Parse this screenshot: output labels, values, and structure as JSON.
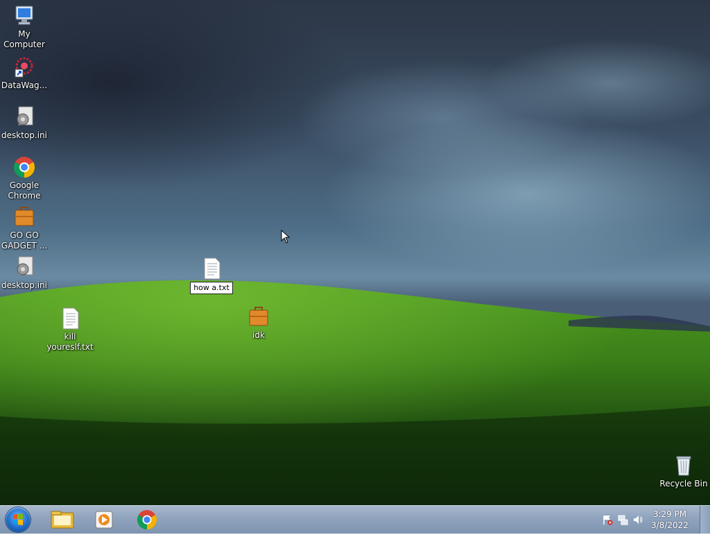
{
  "desktop": {
    "icons": [
      {
        "label": "My Computer",
        "icon": "computer-icon"
      },
      {
        "label": "DataWag...",
        "icon": "shortcut-app-icon"
      },
      {
        "label": "desktop.ini",
        "icon": "gear-settings-file-icon"
      },
      {
        "label": "Google Chrome",
        "icon": "chrome-icon"
      },
      {
        "label": "GO GO GADGET ...",
        "icon": "briefcase-icon"
      },
      {
        "label": "desktop.ini",
        "icon": "gear-settings-file-icon"
      },
      {
        "label": "how a.txt",
        "icon": "text-file-icon",
        "state": "renaming"
      },
      {
        "label": "kill youreslf.txt",
        "icon": "text-file-icon"
      },
      {
        "label": "idk",
        "icon": "briefcase-icon"
      },
      {
        "label": "Recycle Bin",
        "icon": "recycle-bin-icon"
      }
    ]
  },
  "taskbar": {
    "pinned": [
      "file-explorer-icon",
      "media-player-icon",
      "chrome-icon"
    ],
    "tray_icons": [
      "action-center-flag-icon",
      "network-icon",
      "volume-icon"
    ],
    "clock_time": "3:29 PM",
    "clock_date": "3/8/2022"
  },
  "colors": {
    "taskbar": "#8fa3bd",
    "hill": "#3f8a1e",
    "sky": "#4e6d86"
  }
}
